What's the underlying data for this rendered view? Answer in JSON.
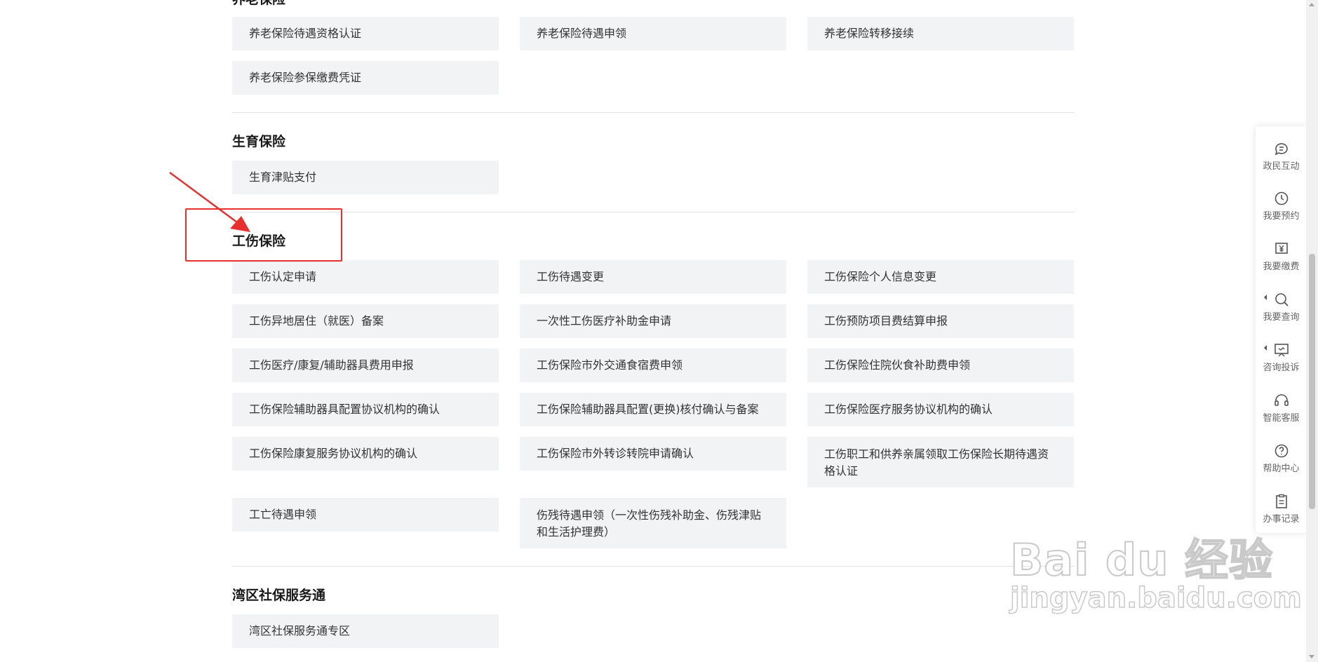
{
  "sections": {
    "pension": {
      "title": "养老保险",
      "items": [
        "养老保险待遇资格认证",
        "养老保险待遇申领",
        "养老保险转移接续",
        "养老保险参保缴费凭证"
      ]
    },
    "maternity": {
      "title": "生育保险",
      "items": [
        "生育津贴支付"
      ]
    },
    "injury": {
      "title": "工伤保险",
      "items": [
        "工伤认定申请",
        "工伤待遇变更",
        "工伤保险个人信息变更",
        "工伤异地居住（就医）备案",
        "一次性工伤医疗补助金申请",
        "工伤预防项目费结算申报",
        "工伤医疗/康复/辅助器具费用申报",
        "工伤保险市外交通食宿费申领",
        "工伤保险住院伙食补助费申领",
        "工伤保险辅助器具配置协议机构的确认",
        "工伤保险辅助器具配置(更换)核付确认与备案",
        "工伤保险医疗服务协议机构的确认",
        "工伤保险康复服务协议机构的确认",
        "工伤保险市外转诊转院申请确认",
        "工伤职工和供养亲属领取工伤保险长期待遇资格认证",
        "工亡待遇申领",
        "伤残待遇申领（一次性伤残补助金、伤残津贴和生活护理费）"
      ]
    },
    "bay_area": {
      "title": "湾区社保服务通",
      "items": [
        "湾区社保服务通专区"
      ]
    }
  },
  "toolbar": {
    "items": [
      {
        "label": "政民互动",
        "icon": "chat-icon"
      },
      {
        "label": "我要预约",
        "icon": "clock-icon"
      },
      {
        "label": "我要缴费",
        "icon": "payment-icon"
      },
      {
        "label": "我要查询",
        "icon": "search-icon"
      },
      {
        "label": "咨询投诉",
        "icon": "consult-icon"
      },
      {
        "label": "智能客服",
        "icon": "headset-icon"
      },
      {
        "label": "帮助中心",
        "icon": "help-icon"
      },
      {
        "label": "办事记录",
        "icon": "clipboard-icon"
      }
    ]
  },
  "annotation": {
    "color": "#e8302e"
  },
  "watermark": {
    "main": "Bai du 经验",
    "sub": "jingyan.baidu.com"
  }
}
